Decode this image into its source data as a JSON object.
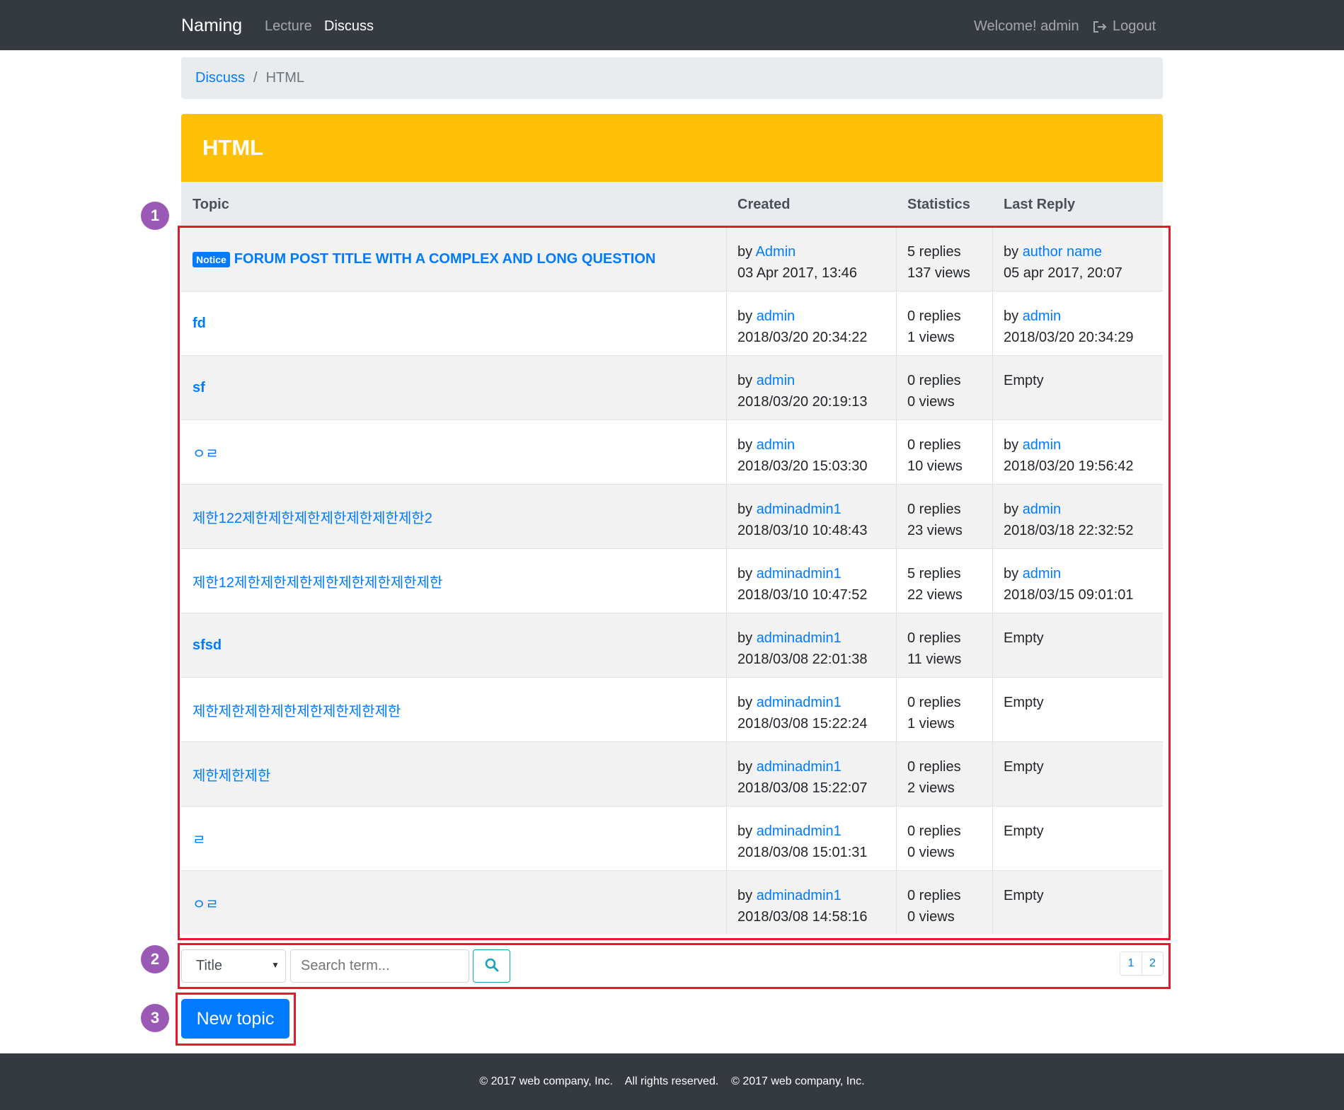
{
  "navbar": {
    "brand": "Naming",
    "links": [
      "Lecture",
      "Discuss"
    ],
    "welcome": "Welcome! admin",
    "logout": "Logout"
  },
  "breadcrumb": {
    "parent": "Discuss",
    "separator": "/",
    "current": "HTML"
  },
  "board": {
    "title": "HTML",
    "header_color": "#ffc107",
    "columns": [
      "Topic",
      "Created",
      "Statistics",
      "Last Reply"
    ],
    "rows": [
      {
        "badge": "Notice",
        "title": "FORUM POST TITLE WITH A COMPLEX AND LONG QUESTION",
        "created_by": "by ",
        "created_user": "Admin",
        "created_at": "03 Apr 2017, 13:46",
        "replies": "5 replies",
        "views": "137 views",
        "last_by": "by ",
        "last_user": "author name",
        "last_at": "05 apr 2017, 20:07"
      },
      {
        "badge": "",
        "title": "fd",
        "created_by": "by ",
        "created_user": "admin",
        "created_at": "2018/03/20 20:34:22",
        "replies": "0 replies",
        "views": "1 views",
        "last_by": "by ",
        "last_user": "admin",
        "last_at": "2018/03/20 20:34:29"
      },
      {
        "badge": "",
        "title": "sf",
        "created_by": "by ",
        "created_user": "admin",
        "created_at": "2018/03/20 20:19:13",
        "replies": "0 replies",
        "views": "0 views",
        "last_by": "Empty",
        "last_user": "",
        "last_at": ""
      },
      {
        "badge": "",
        "title": "ㅇㄹ",
        "created_by": "by ",
        "created_user": "admin",
        "created_at": "2018/03/20 15:03:30",
        "replies": "0 replies",
        "views": "10 views",
        "last_by": "by ",
        "last_user": "admin",
        "last_at": "2018/03/20 19:56:42"
      },
      {
        "badge": "",
        "title": "제한122제한제한제한제한제한제한제한2",
        "created_by": "by ",
        "created_user": "adminadmin1",
        "created_at": "2018/03/10 10:48:43",
        "replies": "0 replies",
        "views": "23 views",
        "last_by": "by ",
        "last_user": "admin",
        "last_at": "2018/03/18 22:32:52"
      },
      {
        "badge": "",
        "title": "제한12제한제한제한제한제한제한제한제한",
        "created_by": "by ",
        "created_user": "adminadmin1",
        "created_at": "2018/03/10 10:47:52",
        "replies": "5 replies",
        "views": "22 views",
        "last_by": "by ",
        "last_user": "admin",
        "last_at": "2018/03/15 09:01:01"
      },
      {
        "badge": "",
        "title": "sfsd",
        "created_by": "by ",
        "created_user": "adminadmin1",
        "created_at": "2018/03/08 22:01:38",
        "replies": "0 replies",
        "views": "11 views",
        "last_by": "Empty",
        "last_user": "",
        "last_at": ""
      },
      {
        "badge": "",
        "title": "제한제한제한제한제한제한제한제한",
        "created_by": "by ",
        "created_user": "adminadmin1",
        "created_at": "2018/03/08 15:22:24",
        "replies": "0 replies",
        "views": "1 views",
        "last_by": "Empty",
        "last_user": "",
        "last_at": ""
      },
      {
        "badge": "",
        "title": "제한제한제한",
        "created_by": "by ",
        "created_user": "adminadmin1",
        "created_at": "2018/03/08 15:22:07",
        "replies": "0 replies",
        "views": "2 views",
        "last_by": "Empty",
        "last_user": "",
        "last_at": ""
      },
      {
        "badge": "",
        "title": "ㄹ",
        "created_by": "by ",
        "created_user": "adminadmin1",
        "created_at": "2018/03/08 15:01:31",
        "replies": "0 replies",
        "views": "0 views",
        "last_by": "Empty",
        "last_user": "",
        "last_at": ""
      },
      {
        "badge": "",
        "title": "ㅇㄹ",
        "created_by": "by ",
        "created_user": "adminadmin1",
        "created_at": "2018/03/08 14:58:16",
        "replies": "0 replies",
        "views": "0 views",
        "last_by": "Empty",
        "last_user": "",
        "last_at": ""
      }
    ]
  },
  "search": {
    "field_selected": "Title",
    "placeholder": "Search term..."
  },
  "pagination": [
    "1",
    "2"
  ],
  "new_topic_label": "New topic",
  "annotations": [
    "1",
    "2",
    "3"
  ],
  "footer": "© 2017 web company, Inc.    All rights reserved.    © 2017 web company, Inc."
}
